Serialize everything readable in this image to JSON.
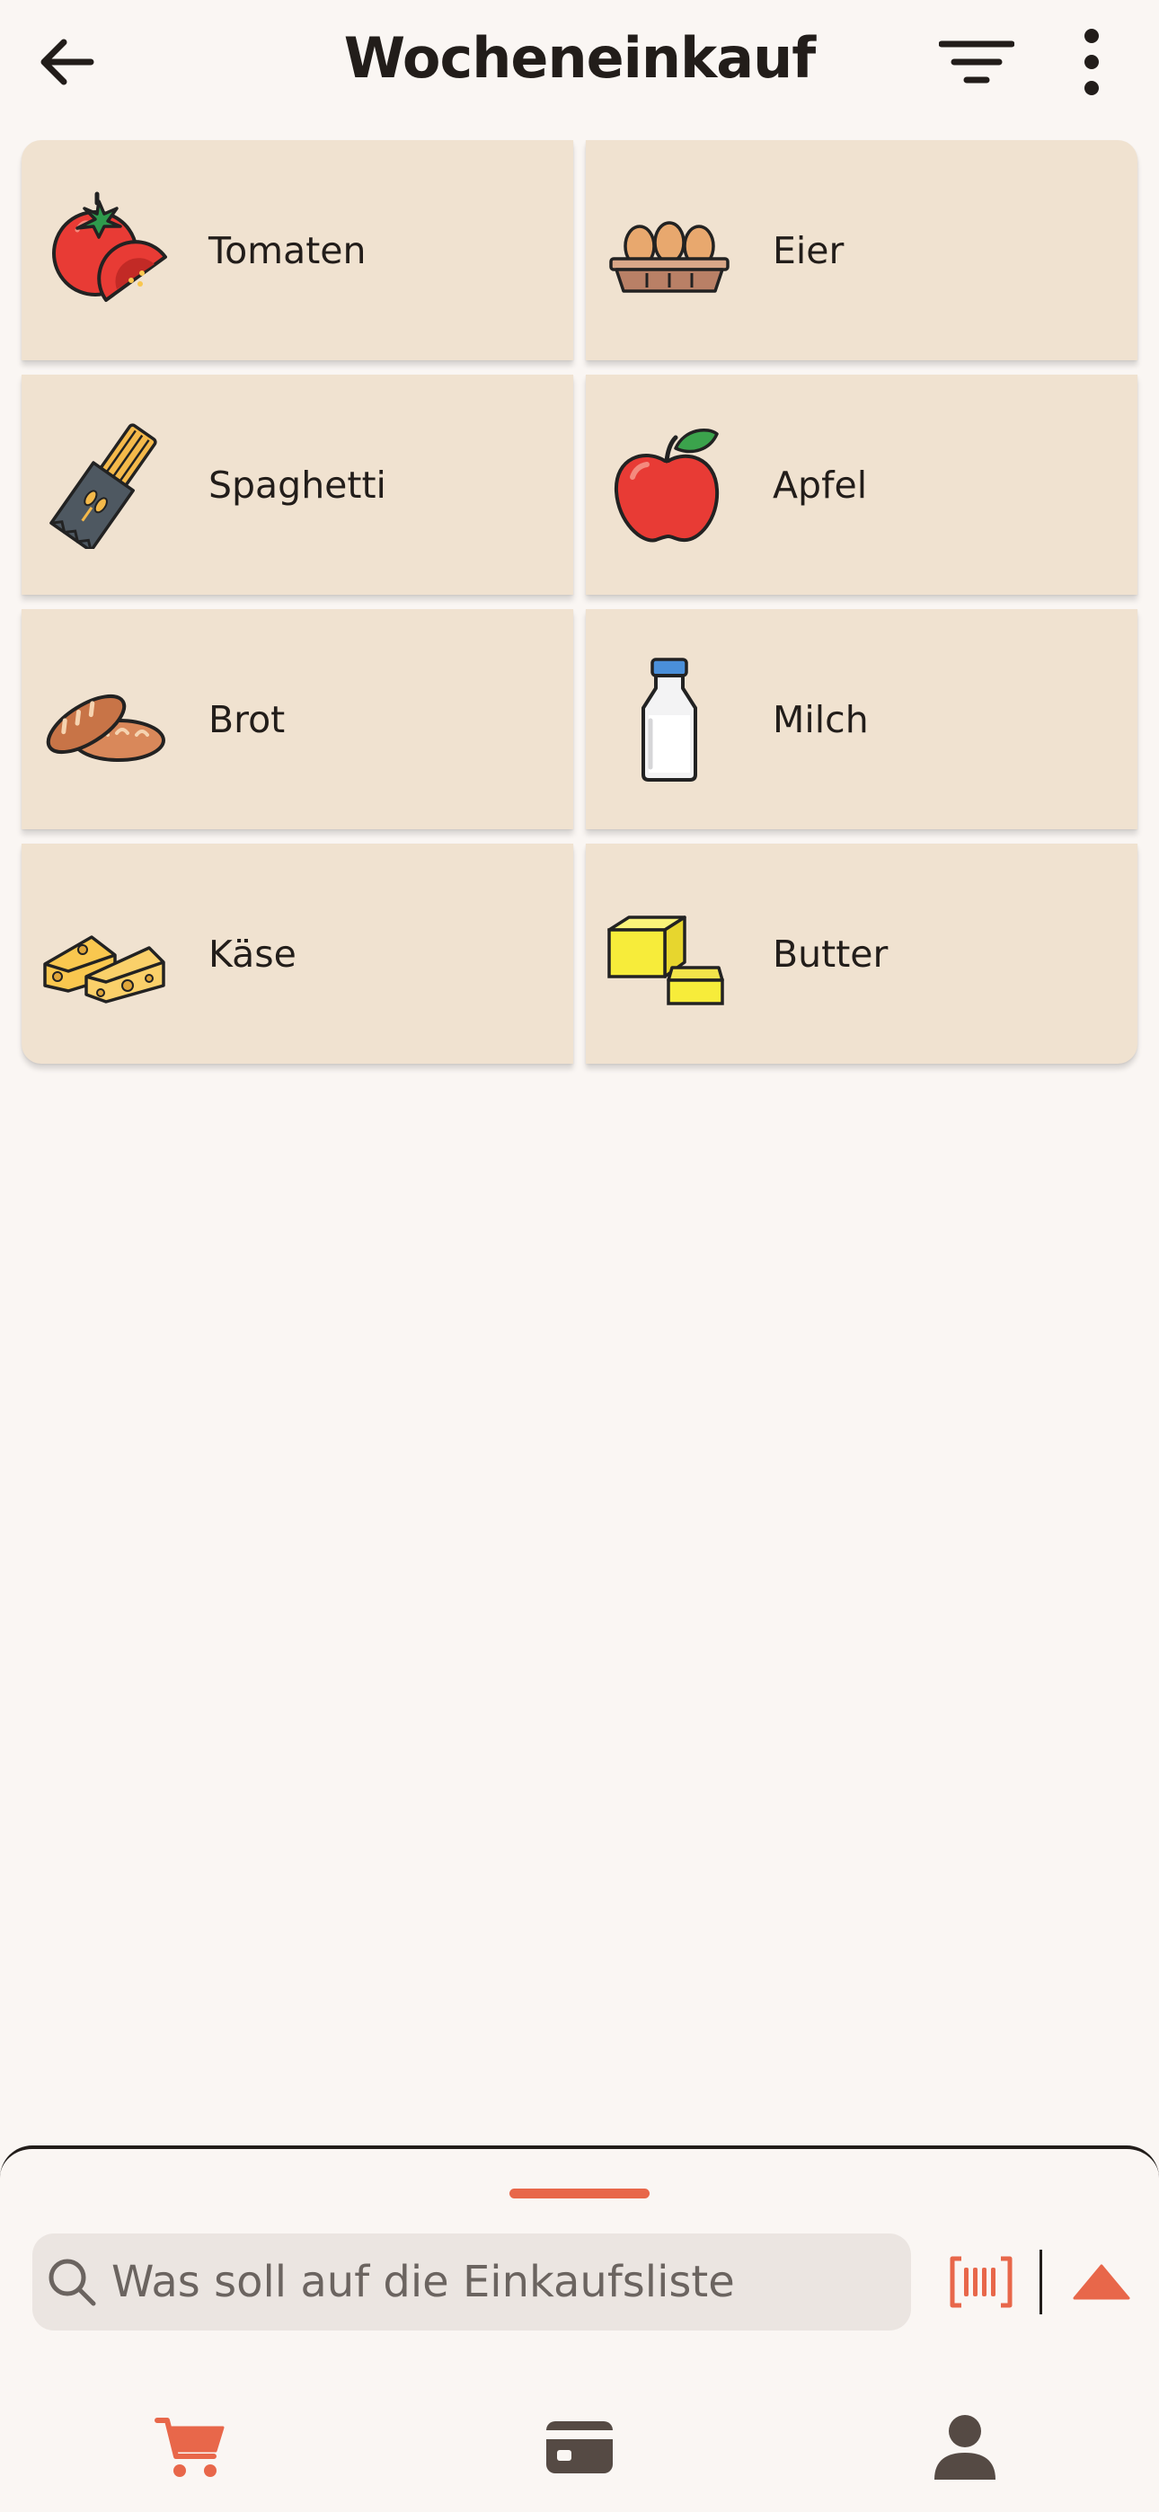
{
  "header": {
    "title": "Wocheneinkauf",
    "back_icon": "arrow-left-icon",
    "filter_icon": "filter-list-icon",
    "more_icon": "more-vertical-icon"
  },
  "items": [
    {
      "label": "Tomaten",
      "icon": "tomato-icon"
    },
    {
      "label": "Eier",
      "icon": "eggs-icon"
    },
    {
      "label": "Spaghetti",
      "icon": "spaghetti-icon"
    },
    {
      "label": "Apfel",
      "icon": "apple-icon"
    },
    {
      "label": "Brot",
      "icon": "bread-icon"
    },
    {
      "label": "Milch",
      "icon": "milk-bottle-icon"
    },
    {
      "label": "Käse",
      "icon": "cheese-icon"
    },
    {
      "label": "Butter",
      "icon": "butter-icon"
    }
  ],
  "search": {
    "placeholder": "Was soll auf die Einkaufsliste",
    "value": "",
    "icon": "search-icon"
  },
  "actions": {
    "barcode_icon": "barcode-scan-icon",
    "expand_icon": "triangle-up-icon"
  },
  "nav": {
    "tabs": [
      {
        "icon": "shopping-cart-icon",
        "active": true
      },
      {
        "icon": "card-icon",
        "active": false
      },
      {
        "icon": "person-icon",
        "active": false
      }
    ]
  },
  "colors": {
    "background": "#FAF6F3",
    "card": "#F0E2D0",
    "accent": "#E8674A",
    "text": "#221D1A",
    "search_bg": "#EBE5E1"
  }
}
